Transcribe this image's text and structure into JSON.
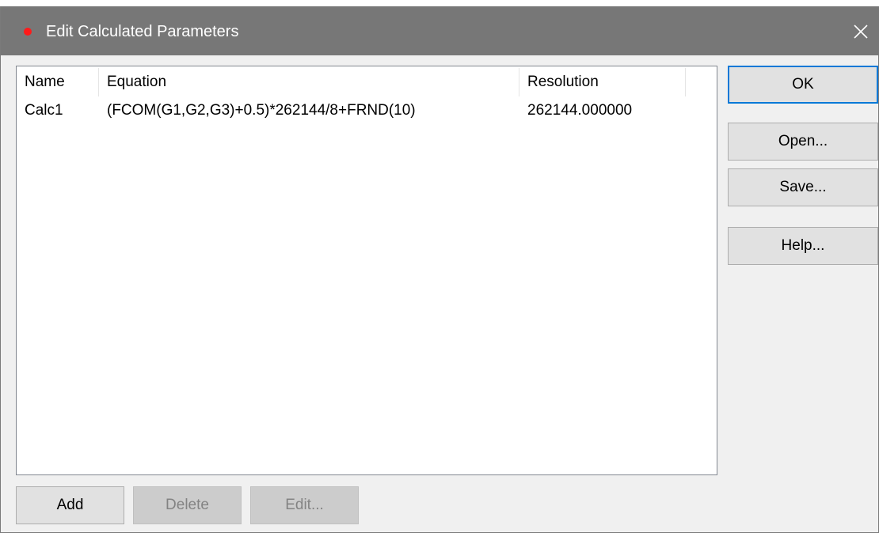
{
  "window": {
    "title": "Edit Calculated Parameters",
    "close_icon": "close-icon",
    "title_dot_color": "#ff1a1a",
    "titlebar_color": "#777777"
  },
  "list": {
    "columns": [
      "Name",
      "Equation",
      "Resolution"
    ],
    "rows": [
      {
        "name": "Calc1",
        "equation": "(FCOM(G1,G2,G3)+0.5)*262144/8+FRND(10)",
        "resolution": "262144.000000"
      }
    ]
  },
  "side_buttons": {
    "ok": "OK",
    "open": "Open...",
    "save": "Save...",
    "help": "Help..."
  },
  "bottom_buttons": {
    "add": "Add",
    "delete": "Delete",
    "edit": "Edit..."
  },
  "colors": {
    "accent": "#0078d7",
    "button_face": "#e1e1e1",
    "disabled_face": "#cccccc"
  }
}
